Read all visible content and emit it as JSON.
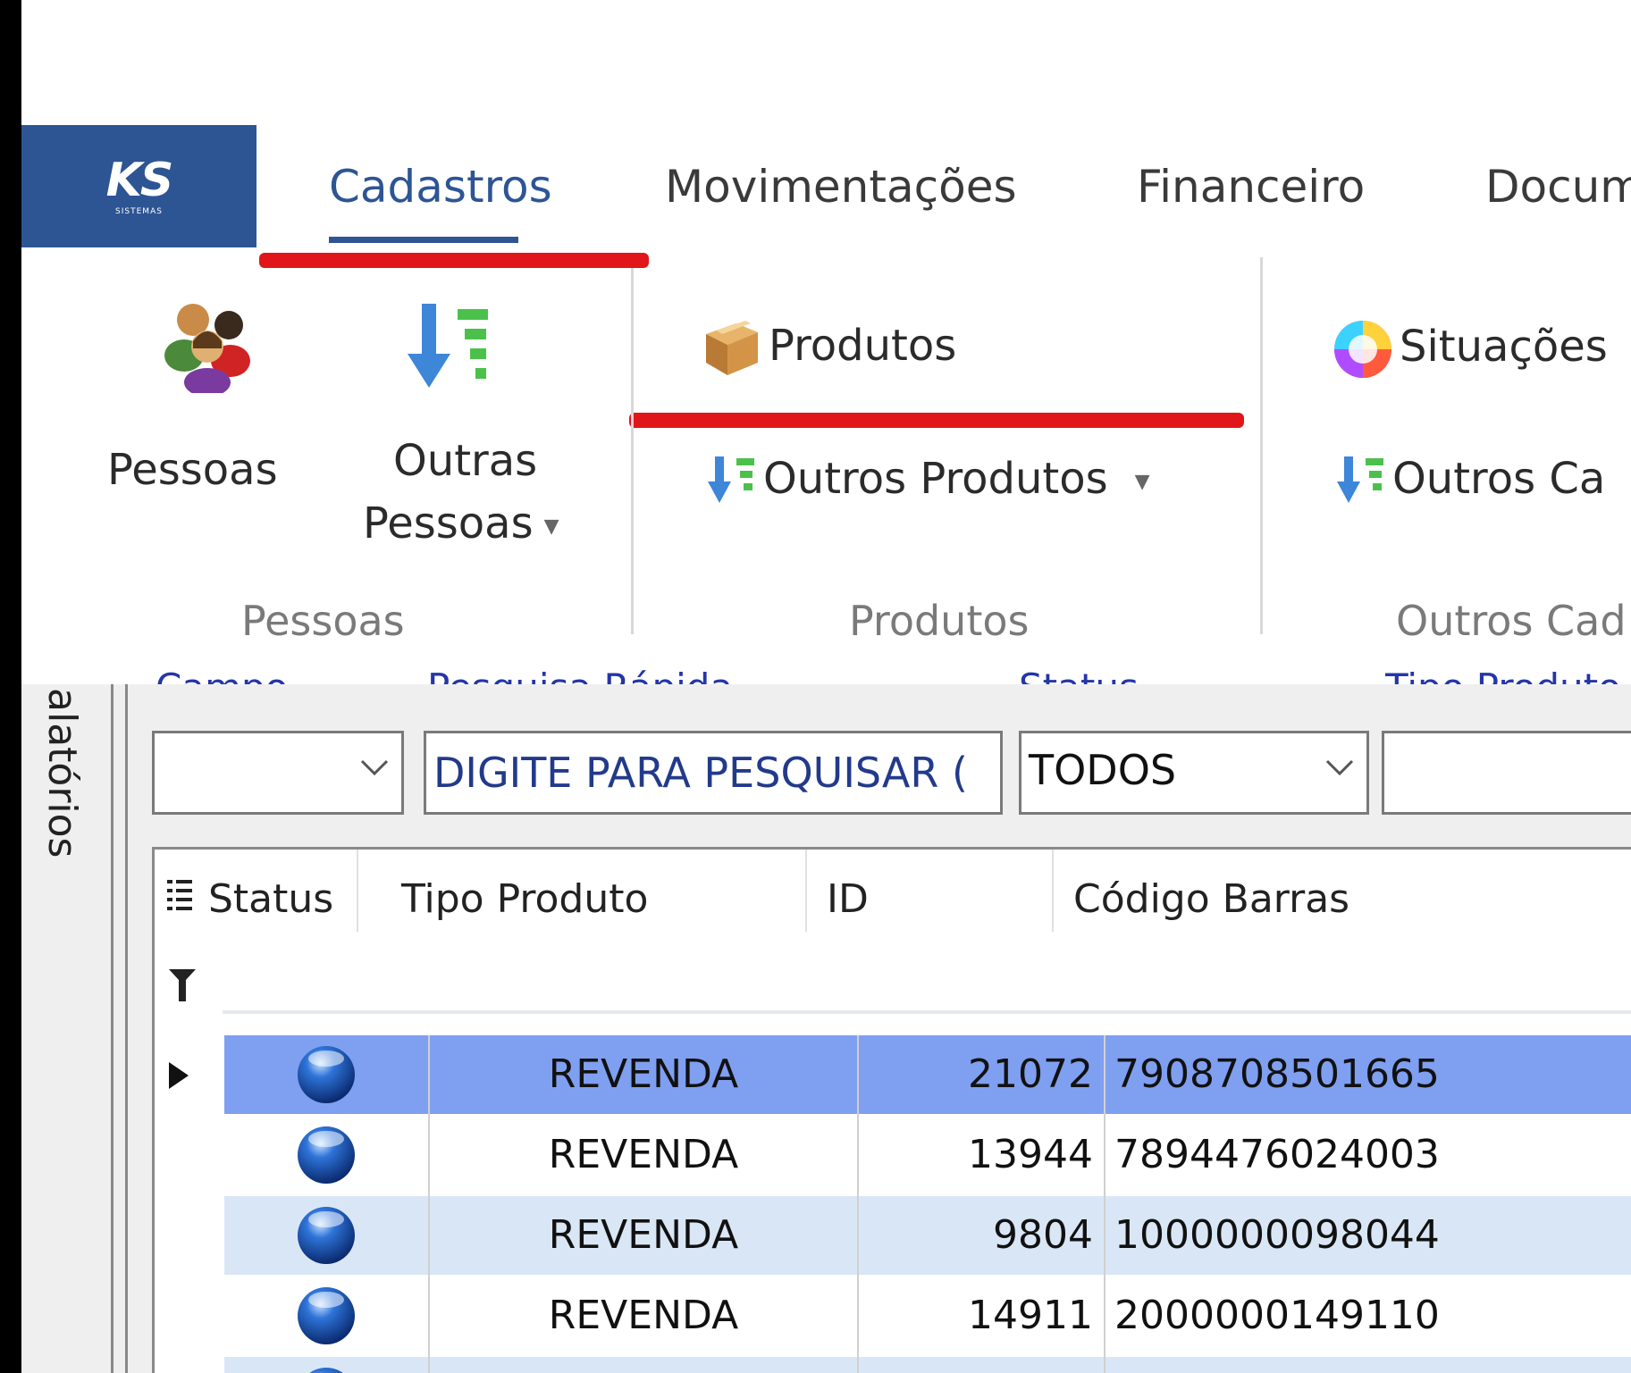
{
  "logo": {
    "main": "KS",
    "sub": "SISTEMAS"
  },
  "menu": {
    "tabs": [
      "Cadastros",
      "Movimentações",
      "Financeiro",
      "Docum"
    ],
    "active": "Cadastros"
  },
  "ribbon": {
    "pessoas_button": "Pessoas",
    "outras_pessoas_line1": "Outras",
    "outras_pessoas_line2": "Pessoas",
    "group_pessoas": "Pessoas",
    "produtos_button": "Produtos",
    "outros_produtos_button": "Outros Produtos",
    "group_produtos": "Produtos",
    "situacoes_button": "Situações",
    "outros_cadastros_button": "Outros Ca",
    "group_outros": "Outros Cad"
  },
  "side_tab": {
    "label": "alatórios"
  },
  "filters": {
    "campo_label": "Campo",
    "campo_value": "",
    "pesquisa_label": "Pesquisa Rápida",
    "pesquisa_placeholder": "DIGITE PARA PESQUISAR (",
    "status_label": "Status",
    "status_value": "TODOS",
    "tipo_label": "Tipo Produto",
    "tipo_value": ""
  },
  "grid": {
    "columns": [
      "Status",
      "Tipo Produto",
      "ID",
      "Código Barras"
    ],
    "rows": [
      {
        "tipo": "REVENDA",
        "id": "21072",
        "barras": "7908708501665",
        "selected": true
      },
      {
        "tipo": "REVENDA",
        "id": "13944",
        "barras": "7894476024003",
        "selected": false
      },
      {
        "tipo": "REVENDA",
        "id": "9804",
        "barras": "1000000098044",
        "selected": false
      },
      {
        "tipo": "REVENDA",
        "id": "14911",
        "barras": "2000000149110",
        "selected": false
      }
    ]
  },
  "colors": {
    "brand": "#2d5594",
    "highlight_red": "#e0161b",
    "row_selected": "#7f9ff0",
    "row_alt": "#d9e6f5",
    "filter_label": "#2436a8"
  }
}
